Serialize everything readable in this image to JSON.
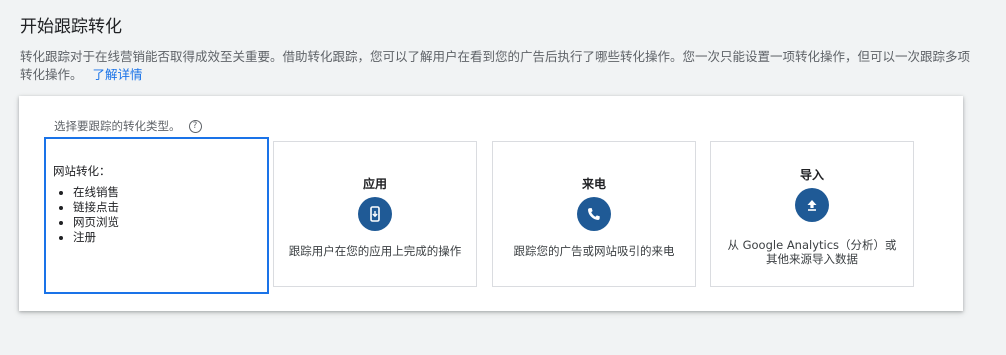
{
  "header": {
    "title": "开始跟踪转化",
    "intro": "转化跟踪对于在线营销能否取得成效至关重要。借助转化跟踪，您可以了解用户在看到您的广告后执行了哪些转化操作。您一次只能设置一项转化操作，但可以一次跟踪多项转化操作。",
    "learn_more": "了解详情"
  },
  "card": {
    "prompt": "选择要跟踪的转化类型。",
    "help_glyph": "?",
    "options": [
      {
        "id": "website",
        "title": "网站转化：",
        "items": [
          "在线销售",
          "链接点击",
          "网页浏览",
          "注册"
        ],
        "selected": true
      },
      {
        "id": "app",
        "title": "应用",
        "icon": "mobile-phone-icon",
        "description": "跟踪用户在您的应用上完成的操作"
      },
      {
        "id": "phone",
        "title": "来电",
        "icon": "phone-call-icon",
        "description": "跟踪您的广告或网站吸引的来电"
      },
      {
        "id": "import",
        "title": "导入",
        "icon": "upload-icon",
        "description": "从 Google Analytics（分析）或其他来源导入数据"
      }
    ]
  },
  "colors": {
    "accent": "#1a73e8",
    "icon_bg": "#1f5a96",
    "background": "#f1f3f4"
  }
}
